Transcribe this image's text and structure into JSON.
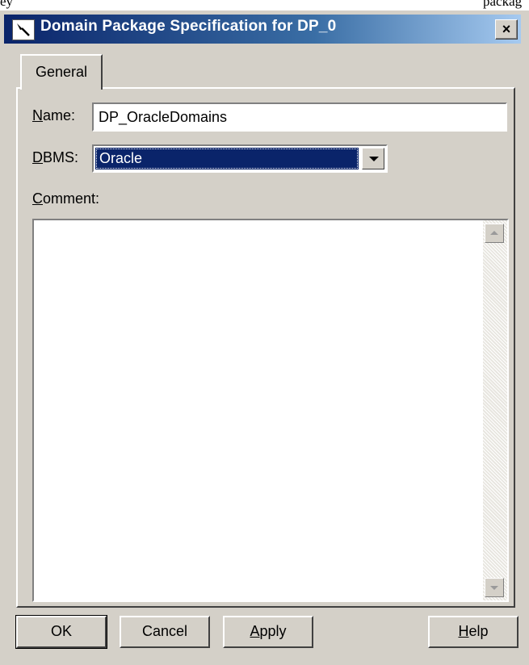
{
  "background_text": {
    "left": "ey",
    "right": "packag"
  },
  "dialog": {
    "title": "Domain Package Specification for DP_0",
    "close_label": "×"
  },
  "tabs": [
    {
      "label": "General",
      "selected": true
    }
  ],
  "form": {
    "name_label_hotkey": "N",
    "name_label_rest": "ame:",
    "name_value": "DP_OracleDomains",
    "dbms_label_hotkey": "D",
    "dbms_label_rest": "BMS:",
    "dbms_value": "Oracle",
    "comment_label_hotkey": "C",
    "comment_label_rest": "omment:",
    "comment_value": ""
  },
  "buttons": {
    "ok": "OK",
    "cancel": "Cancel",
    "apply_hotkey": "A",
    "apply_rest": "pply",
    "help_hotkey": "H",
    "help_rest": "elp"
  },
  "colors": {
    "face": "#d4d0c8",
    "title_active": "#0a246a",
    "selection": "#0a246a"
  },
  "icons": {
    "title": "pen-cursor-icon",
    "close": "close-icon",
    "dropdown": "chevron-down-icon",
    "scroll_up": "arrow-up-icon",
    "scroll_down": "arrow-down-icon"
  }
}
